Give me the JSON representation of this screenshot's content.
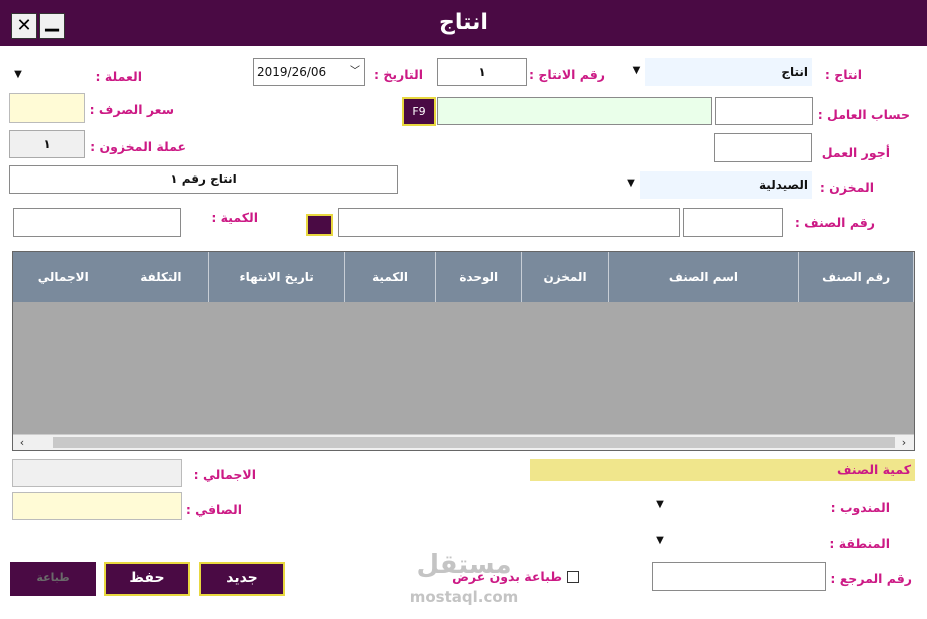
{
  "window": {
    "title": "انتاج",
    "close_glyph": "✕",
    "minimize_glyph": "▁"
  },
  "header_form": {
    "production_label": "انتاج :",
    "production_value": "انتاج",
    "production_no_label": "رقم الانتاج :",
    "production_no_value": "١",
    "date_label": "التاريخ :",
    "date_value": "2019/26/06",
    "currency_label": "العملة :",
    "worker_account_label": "حساب العامل :",
    "f9_hint": "F9",
    "exchange_rate_label": "سعر الصرف :",
    "labor_cost_label": "أجور العمل",
    "stock_currency_label": "عملة المخزون :",
    "stock_currency_value": "١",
    "production_name_value": "انتاج رقم ١",
    "store_label": "المخزن :",
    "store_value": "الصيدلية",
    "item_no_label": "رقم الصنف :",
    "quantity_label": "الكمية :"
  },
  "table": {
    "columns": [
      "رقم الصنف",
      "اسم الصنف",
      "المخزن",
      "الوحدة",
      "الكمية",
      "تاريخ الانتهاء",
      "التكلفة",
      "الاجمالي"
    ]
  },
  "footer": {
    "item_quantity_label": "كمية الصنف",
    "total_label": "الاجمالي :",
    "net_label": "الصافي :",
    "delegate_label": "المندوب :",
    "region_label": "المنطقة :",
    "reference_no_label": "رقم المرجع :",
    "print_without_preview_label": "طباعة بدون عرض",
    "new_button": "جديد",
    "save_button": "حفظ",
    "print_button": "طباعة"
  },
  "watermark": {
    "brand": "مستقل",
    "site": "mostaql.com"
  },
  "colors": {
    "accent": "#4a0a44",
    "label": "#cc1a85",
    "header": "#7a8a9c",
    "grid": "#a8a8a8",
    "highlight": "#f0e68c"
  }
}
